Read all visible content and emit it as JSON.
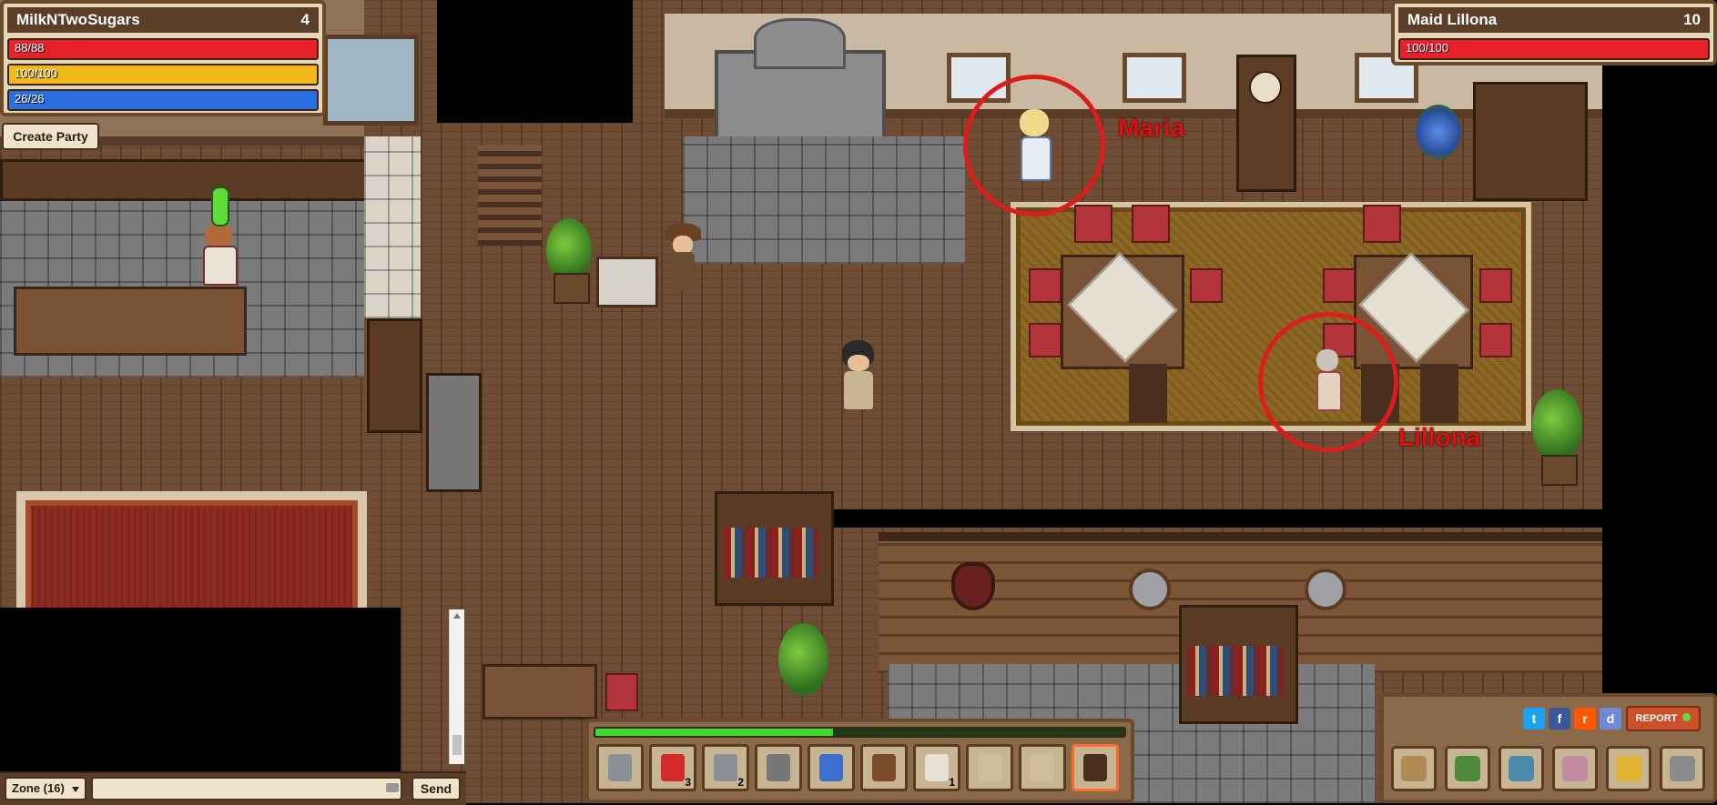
{
  "player": {
    "name": "MilkNTwoSugars",
    "level": "4",
    "hp": {
      "text": "88/88",
      "fraction": 1.0,
      "color": "#e8202a"
    },
    "energy": {
      "text": "100/100",
      "fraction": 1.0,
      "color": "#f2b718"
    },
    "mana": {
      "text": "26/26",
      "fraction": 1.0,
      "color": "#2a6fe0"
    }
  },
  "target": {
    "name": "Maid Lillona",
    "level": "10",
    "hp": {
      "text": "100/100",
      "fraction": 1.0,
      "color": "#e8202a"
    }
  },
  "party": {
    "create_label": "Create Party"
  },
  "annotations": {
    "maria": "Maria",
    "lillona": "Lillona",
    "circle_color": "#dd1c1c"
  },
  "chat": {
    "channel": "Zone (16)",
    "input_value": "",
    "send_label": "Send",
    "keyboard_icon": "keyboard-icon"
  },
  "hotbar": {
    "xp_fraction": 0.45,
    "slots": [
      {
        "icon": "sword-icon",
        "count": ""
      },
      {
        "icon": "health-potion-icon",
        "count": "3"
      },
      {
        "icon": "pickaxe-icon",
        "count": "2"
      },
      {
        "icon": "staff-icon",
        "count": ""
      },
      {
        "icon": "blue-tunic-icon",
        "count": ""
      },
      {
        "icon": "leather-pants-icon",
        "count": ""
      },
      {
        "icon": "feather-icon",
        "count": "1"
      },
      {
        "icon": "cloth-shirt-icon",
        "count": ""
      },
      {
        "icon": "cloth-shirt-icon",
        "count": ""
      },
      {
        "icon": "hat-icon",
        "count": ""
      }
    ]
  },
  "social": {
    "twitter": "t",
    "facebook": "f",
    "reddit": "r",
    "discord": "d",
    "report_label": "REPORT"
  },
  "menu": [
    {
      "icon": "bag-icon"
    },
    {
      "icon": "spellbook-icon"
    },
    {
      "icon": "map-icon"
    },
    {
      "icon": "backpack-icon"
    },
    {
      "icon": "gold-coins-icon"
    },
    {
      "icon": "settings-gear-icon"
    }
  ]
}
